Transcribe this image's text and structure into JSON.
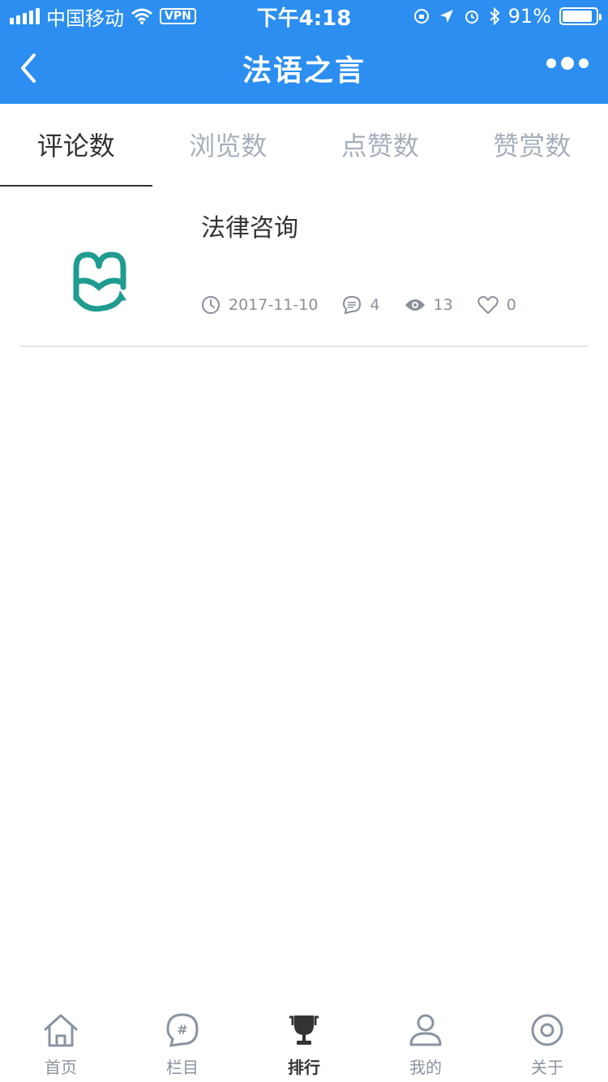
{
  "status_bar": {
    "carrier": "中国移动",
    "vpn": "VPN",
    "time": "下午4:18",
    "battery": "91%",
    "battery_level": 0.91
  },
  "nav": {
    "title": "法语之言"
  },
  "tabs": [
    {
      "label": "评论数",
      "active": true
    },
    {
      "label": "浏览数",
      "active": false
    },
    {
      "label": "点赞数",
      "active": false
    },
    {
      "label": "赞赏数",
      "active": false
    }
  ],
  "items": [
    {
      "title": "法律咨询",
      "date": "2017-11-10",
      "comments": "4",
      "views": "13",
      "likes": "0"
    }
  ],
  "bottom_tabs": [
    {
      "label": "首页",
      "icon": "home-icon",
      "active": false
    },
    {
      "label": "栏目",
      "icon": "hashtag-chat-icon",
      "active": false
    },
    {
      "label": "排行",
      "icon": "trophy-icon",
      "active": true
    },
    {
      "label": "我的",
      "icon": "user-icon",
      "active": false
    },
    {
      "label": "关于",
      "icon": "target-icon",
      "active": false
    }
  ],
  "colors": {
    "primary": "#2b8ef0",
    "logo_teal": "#1f9c8f",
    "inactive": "#a7afbb"
  }
}
